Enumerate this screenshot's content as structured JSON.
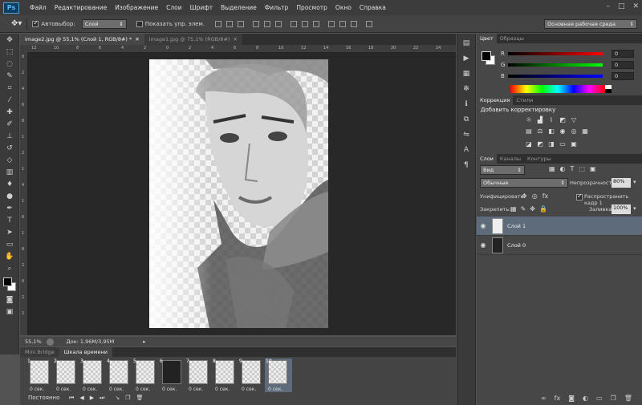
{
  "app": {
    "logo": "Ps"
  },
  "menu": [
    "Файл",
    "Редактирование",
    "Изображение",
    "Слои",
    "Шрифт",
    "Выделение",
    "Фильтр",
    "Просмотр",
    "Окно",
    "Справка"
  ],
  "window_controls": [
    "–",
    "□",
    "✕"
  ],
  "options": {
    "autoselect_label": "Автовыбор:",
    "autoselect_value": "Слой",
    "show_controls_label": "Показать упр. элем.",
    "workspace": "Основная рабочая среда"
  },
  "tools": [
    "move-tool",
    "marquee-tool",
    "lasso-tool",
    "quick-select-tool",
    "crop-tool",
    "eyedropper-tool",
    "healing-tool",
    "brush-tool",
    "stamp-tool",
    "history-brush-tool",
    "eraser-tool",
    "gradient-tool",
    "blur-tool",
    "dodge-tool",
    "pen-tool",
    "type-tool",
    "path-select-tool",
    "shape-tool",
    "hand-tool",
    "zoom-tool"
  ],
  "documents": {
    "tabs": [
      {
        "label": "image2.jpg @ 55,1% (Слой 1, RGB/8#) *",
        "active": true
      },
      {
        "label": "image1.jpg @ 75,1% (RGB/8#)",
        "active": false
      }
    ],
    "ruler_top": [
      "12",
      "10",
      "8",
      "6",
      "4",
      "2",
      "0",
      "2",
      "4",
      "6",
      "8",
      "10",
      "12",
      "14",
      "16",
      "18",
      "20",
      "22",
      "24"
    ],
    "ruler_left": [
      "0",
      "2",
      "4",
      "6",
      "8",
      "1",
      "2",
      "1",
      "4",
      "1",
      "6",
      "1",
      "8",
      "2",
      "0",
      "2",
      "2"
    ]
  },
  "status": {
    "zoom": "55,1%",
    "doc": "Док: 1,96M/3,95M"
  },
  "timeline": {
    "tabs": [
      "Mini Bridge",
      "Шкала времени"
    ],
    "frames": [
      {
        "num": "1",
        "delay": "0 сек."
      },
      {
        "num": "2",
        "delay": "0 сек."
      },
      {
        "num": "3",
        "delay": "0 сек."
      },
      {
        "num": "4",
        "delay": "0 сек."
      },
      {
        "num": "5",
        "delay": "0 сек."
      },
      {
        "num": "6",
        "delay": "0 сек."
      },
      {
        "num": "7",
        "delay": "0 сек."
      },
      {
        "num": "8",
        "delay": "0 сек."
      },
      {
        "num": "9",
        "delay": "0 сек."
      },
      {
        "num": "10",
        "delay": "0 сек."
      }
    ],
    "loop": "Постоянно"
  },
  "color_panel": {
    "tabs": [
      "Цвет",
      "Образцы"
    ],
    "channels": [
      {
        "label": "R",
        "value": "0",
        "color": "#ff0000"
      },
      {
        "label": "G",
        "value": "0",
        "color": "#00ff00"
      },
      {
        "label": "B",
        "value": "0",
        "color": "#0000ff"
      }
    ]
  },
  "adjust_panel": {
    "tabs": [
      "Коррекция",
      "Стили"
    ],
    "title": "Добавить корректировку"
  },
  "layers_panel": {
    "tabs": [
      "Слои",
      "Каналы",
      "Контуры"
    ],
    "filter": "Вид",
    "blend_mode": "Обычные",
    "opacity_label": "Непрозрачность:",
    "opacity_value": "80%",
    "unify_label": "Унифицировать:",
    "propagate_label": "Распространить кадр 1",
    "lock_label": "Закрепить:",
    "fill_label": "Заливка:",
    "fill_value": "100%",
    "layers": [
      {
        "name": "Слой 1",
        "selected": true
      },
      {
        "name": "Слой 0",
        "selected": false
      }
    ]
  }
}
